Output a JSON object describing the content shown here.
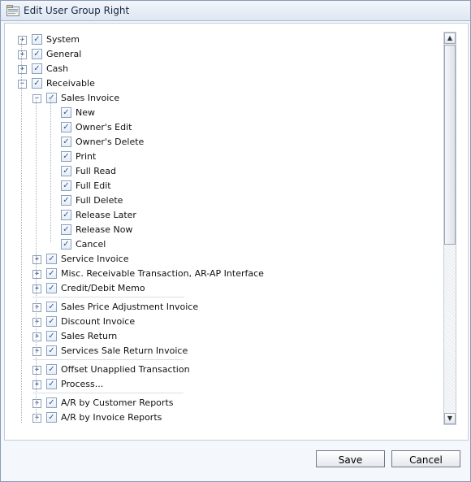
{
  "window": {
    "title": "Edit User Group Right"
  },
  "tree": [
    {
      "label": "System",
      "expander": "+",
      "checked": true
    },
    {
      "label": "General",
      "expander": "+",
      "checked": true
    },
    {
      "label": "Cash",
      "expander": "+",
      "checked": true
    },
    {
      "label": "Receivable",
      "expander": "-",
      "checked": true
    },
    {
      "label": "Sales Invoice",
      "expander": "-",
      "checked": true
    },
    {
      "label": "New",
      "checked": true
    },
    {
      "label": "Owner's Edit",
      "checked": true
    },
    {
      "label": "Owner's Delete",
      "checked": true
    },
    {
      "label": "Print",
      "checked": true
    },
    {
      "label": "Full Read",
      "checked": true
    },
    {
      "label": "Full Edit",
      "checked": true
    },
    {
      "label": "Full Delete",
      "checked": true
    },
    {
      "label": "Release Later",
      "checked": true
    },
    {
      "label": "Release Now",
      "checked": true
    },
    {
      "label": "Cancel",
      "checked": true
    },
    {
      "label": "Service Invoice",
      "expander": "+",
      "checked": true
    },
    {
      "label": "Misc. Receivable Transaction, AR-AP Interface",
      "expander": "+",
      "checked": true
    },
    {
      "label": "Credit/Debit Memo",
      "expander": "+",
      "checked": true
    },
    {
      "label": "Sales Price Adjustment Invoice",
      "expander": "+",
      "checked": true
    },
    {
      "label": "Discount Invoice",
      "expander": "+",
      "checked": true
    },
    {
      "label": "Sales Return",
      "expander": "+",
      "checked": true
    },
    {
      "label": "Services Sale Return Invoice",
      "expander": "+",
      "checked": true
    },
    {
      "label": "Offset Unapplied Transaction",
      "expander": "+",
      "checked": true
    },
    {
      "label": "Process...",
      "expander": "+",
      "checked": true
    },
    {
      "label": "A/R by Customer Reports",
      "expander": "+",
      "checked": true
    },
    {
      "label": "A/R by Invoice Reports",
      "expander": "+",
      "checked": true
    }
  ],
  "buttons": {
    "save": "Save",
    "cancel": "Cancel"
  },
  "scrollbar": {
    "position": 0.0,
    "visible_fraction": 0.52
  },
  "colors": {
    "accent": "#2f5a94",
    "border": "#8a9bb3"
  }
}
